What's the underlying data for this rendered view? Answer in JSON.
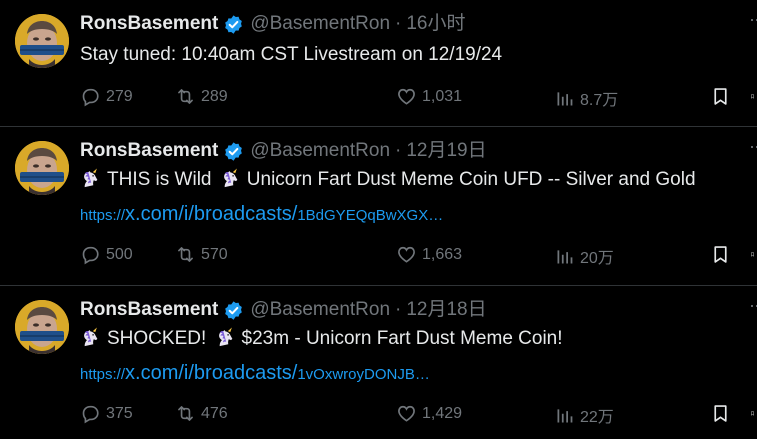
{
  "tweets": [
    {
      "name": "RonsBasement",
      "handle": "@BasementRon",
      "separator": "·",
      "time": "16小时",
      "text": "Stay tuned:  10:40am CST Livestream on 12/19/24",
      "link": null,
      "replies": "279",
      "retweets": "289",
      "likes": "1,031",
      "views": "8.7万"
    },
    {
      "name": "RonsBasement",
      "handle": "@BasementRon",
      "separator": "·",
      "time": "12月19日",
      "text_a": "THIS is Wild",
      "text_b": "Unicorn Fart Dust Meme Coin UFD -- Silver and Gold",
      "link": {
        "prefix": "https://",
        "domain": "x.com/i/broadcasts/",
        "suffix": "1BdGYEQqBwXGX…"
      },
      "replies": "500",
      "retweets": "570",
      "likes": "1,663",
      "views": "20万"
    },
    {
      "name": "RonsBasement",
      "handle": "@BasementRon",
      "separator": "·",
      "time": "12月18日",
      "text_a": "SHOCKED!",
      "text_b": "$23m - Unicorn Fart Dust Meme Coin!",
      "link": {
        "prefix": "https://",
        "domain": "x.com/i/broadcasts/",
        "suffix": "1vOxwroyDONJB…"
      },
      "replies": "375",
      "retweets": "476",
      "likes": "1,429",
      "views": "22万"
    }
  ],
  "icons": {
    "reply": "reply-icon",
    "retweet": "retweet-icon",
    "like": "heart-icon",
    "views": "views-icon",
    "bookmark": "bookmark-icon",
    "verified": "verified-badge-icon",
    "unicorn": "unicorn-emoji-icon"
  },
  "colors": {
    "background": "#000000",
    "text": "#e7e9ea",
    "muted": "#71767b",
    "link": "#1d9bf0",
    "verified": "#1d9bf0",
    "divider": "#2f3336"
  }
}
